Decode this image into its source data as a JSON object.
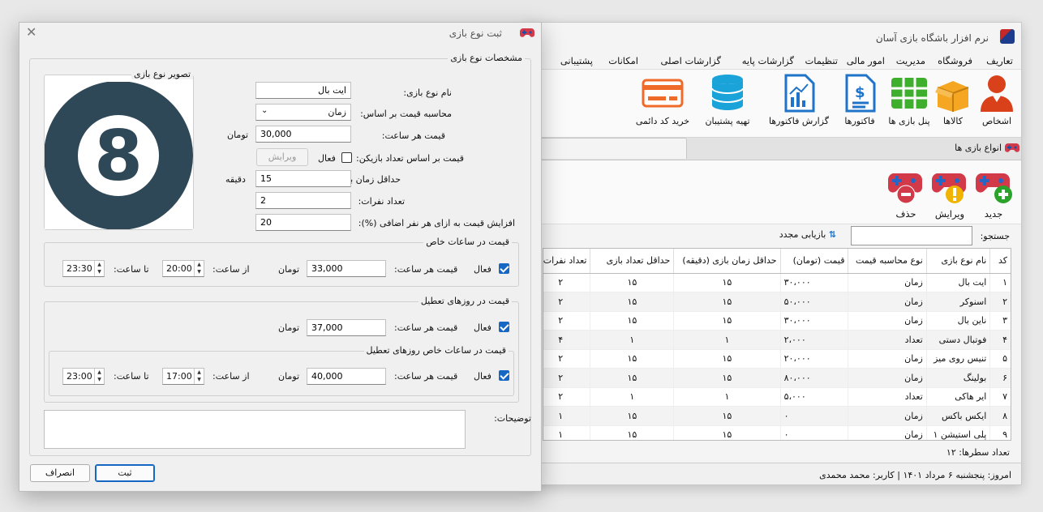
{
  "main_window": {
    "title": "نرم افزار باشگاه بازی آسان",
    "menu": [
      "تعاریف",
      "فروشگاه",
      "مدیریت",
      "امور مالی",
      "تنظیمات",
      "گزارشات پایه",
      "گزارشات اصلی",
      "امکانات",
      "پشتیبانی"
    ],
    "ribbon": [
      {
        "label": "اشخاص",
        "icon": "person-icon"
      },
      {
        "label": "کالاها",
        "icon": "box-icon"
      },
      {
        "label": "پنل بازی ها",
        "icon": "grid-icon"
      },
      {
        "label": "فاکتورها",
        "icon": "invoice-icon"
      },
      {
        "label": "گزارش فاکتورها",
        "icon": "report-icon"
      },
      {
        "label": "تهیه پشتیبان",
        "icon": "database-icon"
      },
      {
        "label": "خرید کد دائمی",
        "icon": "credit-card-icon"
      }
    ],
    "doc_tab": "انواع بازی ها",
    "toolbar": {
      "new": "جدید",
      "edit": "ویرایش",
      "delete": "حذف"
    },
    "search_label": "جستجو:",
    "search_value": "",
    "refresh_label": "بازیابی مجدد",
    "grid": {
      "columns": [
        "کد",
        "نام نوع بازی",
        "نوع محاسبه قیمت",
        "قیمت (تومان)",
        "حداقل زمان بازی (دقیقه)",
        "حداقل تعداد بازی",
        "تعداد نفرات"
      ],
      "rows": [
        [
          "۱",
          "ایت بال",
          "زمان",
          "۳۰،۰۰۰",
          "۱۵",
          "۱۵",
          "۲"
        ],
        [
          "۲",
          "اسنوکر",
          "زمان",
          "۵۰،۰۰۰",
          "۱۵",
          "۱۵",
          "۲"
        ],
        [
          "۳",
          "ناین بال",
          "زمان",
          "۳۰،۰۰۰",
          "۱۵",
          "۱۵",
          "۲"
        ],
        [
          "۴",
          "فوتبال دستی",
          "تعداد",
          "۲،۰۰۰",
          "۱",
          "۱",
          "۴"
        ],
        [
          "۵",
          "تنیس روی میز",
          "زمان",
          "۲۰،۰۰۰",
          "۱۵",
          "۱۵",
          "۲"
        ],
        [
          "۶",
          "بولینگ",
          "زمان",
          "۸۰،۰۰۰",
          "۱۵",
          "۱۵",
          "۲"
        ],
        [
          "۷",
          "ایر هاکی",
          "تعداد",
          "۵،۰۰۰",
          "۱",
          "۱",
          "۲"
        ],
        [
          "۸",
          "ایکس باکس",
          "زمان",
          "۰",
          "۱۵",
          "۱۵",
          "۱"
        ],
        [
          "۹",
          "پلی استیشن ۱",
          "زمان",
          "۰",
          "۱۵",
          "۱۵",
          "۱"
        ]
      ]
    },
    "row_count_label": "تعداد سطرها:",
    "row_count": "۱۲",
    "status": "امروز: پنجشنبه ۶ مرداد ۱۴۰۱   |   کاربر: محمد محمدی"
  },
  "dialog": {
    "title": "ثبت نوع بازی",
    "group_main": "مشخصات نوع بازی",
    "image_group": "تصویر نوع بازی",
    "image_text": "8",
    "name_label": "نام نوع بازی:",
    "name_value": "ایت بال",
    "calc_label": "محاسبه قیمت بر اساس:",
    "calc_value": "زمان",
    "hour_price_label": "قیمت هر ساعت:",
    "hour_price_value": "30,000",
    "toman": "تومان",
    "by_players_label": "قیمت بر اساس تعداد بازیکن:",
    "active_label": "فعال",
    "edit_btn": "ویرایش",
    "min_time_label": "حداقل زمان بازی:",
    "min_time_value": "15",
    "minute": "دقیقه",
    "players_label": "تعداد نفرات:",
    "players_value": "2",
    "extra_label": "افزایش قیمت به ازای هر نفر اضافی (%):",
    "extra_value": "20",
    "special_hours": {
      "title": "قیمت در ساعات خاص",
      "active": "فعال",
      "price_label": "قیمت هر ساعت:",
      "price_value": "33,000",
      "from_label": "از ساعت:",
      "from_value": "20:00",
      "to_label": "تا ساعت:",
      "to_value": "23:30"
    },
    "holidays": {
      "title": "قیمت در روزهای تعطیل",
      "active": "فعال",
      "price_label": "قیمت هر ساعت:",
      "price_value": "37,000"
    },
    "holiday_hours": {
      "title": "قیمت در ساعات خاص روزهای تعطیل",
      "active": "فعال",
      "price_label": "قیمت هر ساعت:",
      "price_value": "40,000",
      "from_label": "از ساعت:",
      "from_value": "17:00",
      "to_label": "تا ساعت:",
      "to_value": "23:00"
    },
    "notes_label": "توضیحات:",
    "notes_value": "",
    "submit": "ثبت",
    "cancel": "انصراف"
  }
}
